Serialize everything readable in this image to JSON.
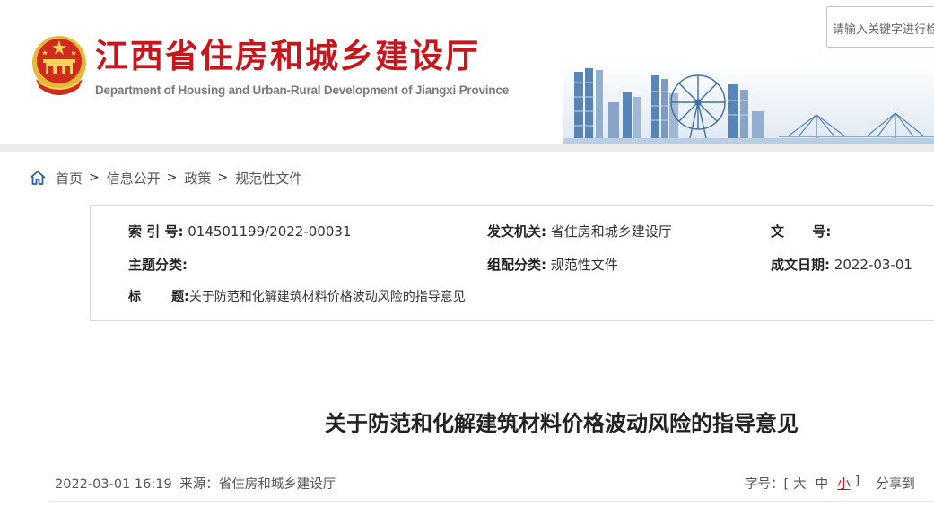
{
  "header": {
    "title": "江西省住房和城乡建设厅",
    "subtitle": "Department of Housing and Urban-Rural Development of Jiangxi Province",
    "search_placeholder": "请输入关键字进行检索"
  },
  "breadcrumb": [
    "首页",
    "信息公开",
    "政策",
    "规范性文件"
  ],
  "breadcrumb_separator": ">",
  "info": {
    "index_label": "索 引 号:",
    "index_value": "014501199/2022-00031",
    "issuer_label": "发文机关:",
    "issuer_value": "省住房和城乡建设厅",
    "docno_label": "文    号:",
    "docno_value": "",
    "topic_label": "主题分类:",
    "topic_value": "",
    "category_label": "组配分类:",
    "category_value": "规范性文件",
    "date_label": "成文日期:",
    "date_value": "2022-03-01",
    "title_label": "标      题:",
    "title_value": "关于防范和化解建筑材料价格波动风险的指导意见"
  },
  "article": {
    "title": "关于防范和化解建筑材料价格波动风险的指导意见",
    "datetime": "2022-03-01 16:19",
    "source_label": "来源：",
    "source": "省住房和城乡建设厅",
    "fontsize_label": "字号：[",
    "fontsize_large": "大",
    "fontsize_medium": "中",
    "fontsize_small": "小",
    "fontsize_close": "]",
    "share_label": "分享到"
  },
  "colors": {
    "brand_red": "#c8161d",
    "skyline_blue": "#3f6fa6"
  }
}
